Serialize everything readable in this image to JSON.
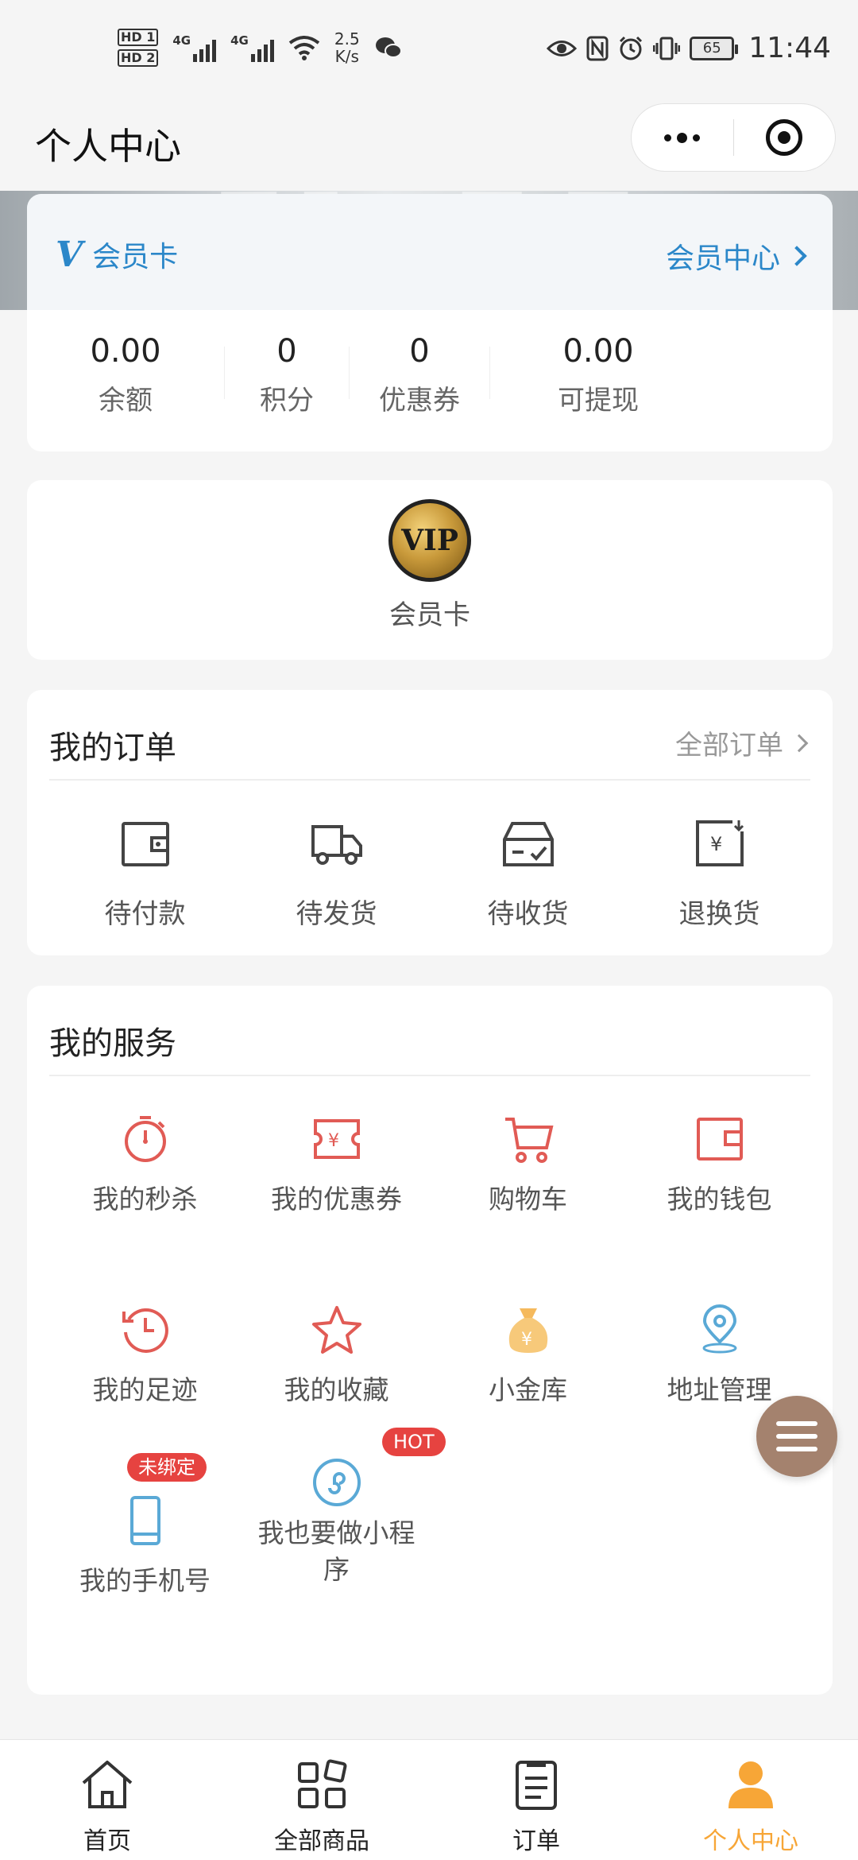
{
  "status_bar": {
    "hd1": "HD 1",
    "hd2": "HD 2",
    "net1": "4G",
    "net2": "4G",
    "speed_value": "2.5",
    "speed_unit": "K/s",
    "battery": "65",
    "time": "11:44"
  },
  "navbar": {
    "title": "个人中心"
  },
  "member_card": {
    "title": "会员卡",
    "center_link": "会员中心",
    "stats": [
      {
        "value": "0.00",
        "label": "余额"
      },
      {
        "value": "0",
        "label": "积分"
      },
      {
        "value": "0",
        "label": "优惠券"
      },
      {
        "value": "0.00",
        "label": "可提现"
      }
    ]
  },
  "vip": {
    "badge_text": "VIP",
    "label": "会员卡"
  },
  "orders": {
    "title": "我的订单",
    "all_link": "全部订单",
    "items": [
      {
        "label": "待付款",
        "icon": "wallet-icon"
      },
      {
        "label": "待发货",
        "icon": "truck-icon"
      },
      {
        "label": "待收货",
        "icon": "inbox-icon"
      },
      {
        "label": "退换货",
        "icon": "refund-icon"
      }
    ]
  },
  "services": {
    "title": "我的服务",
    "items": [
      {
        "label": "我的秒杀",
        "icon": "stopwatch-icon"
      },
      {
        "label": "我的优惠券",
        "icon": "coupon-icon"
      },
      {
        "label": "购物车",
        "icon": "cart-icon"
      },
      {
        "label": "我的钱包",
        "icon": "wallet-icon"
      },
      {
        "label": "我的足迹",
        "icon": "history-icon"
      },
      {
        "label": "我的收藏",
        "icon": "star-icon"
      },
      {
        "label": "小金库",
        "icon": "money-bag-icon"
      },
      {
        "label": "地址管理",
        "icon": "location-icon"
      },
      {
        "label": "我的手机号",
        "icon": "phone-icon",
        "badge": "未绑定"
      },
      {
        "label": "我也要做小程序",
        "icon": "miniprogram-icon",
        "badge": "HOT"
      }
    ]
  },
  "tabbar": {
    "items": [
      {
        "label": "首页",
        "icon": "home-icon"
      },
      {
        "label": "全部商品",
        "icon": "grid-icon"
      },
      {
        "label": "订单",
        "icon": "clipboard-icon"
      },
      {
        "label": "个人中心",
        "icon": "user-icon",
        "active": true
      }
    ]
  },
  "colors": {
    "accent_blue": "#2b87c9",
    "service_red": "#e15b55",
    "active_tab": "#f7a637",
    "float_button": "#a4826e",
    "badge_red": "#e64340"
  }
}
